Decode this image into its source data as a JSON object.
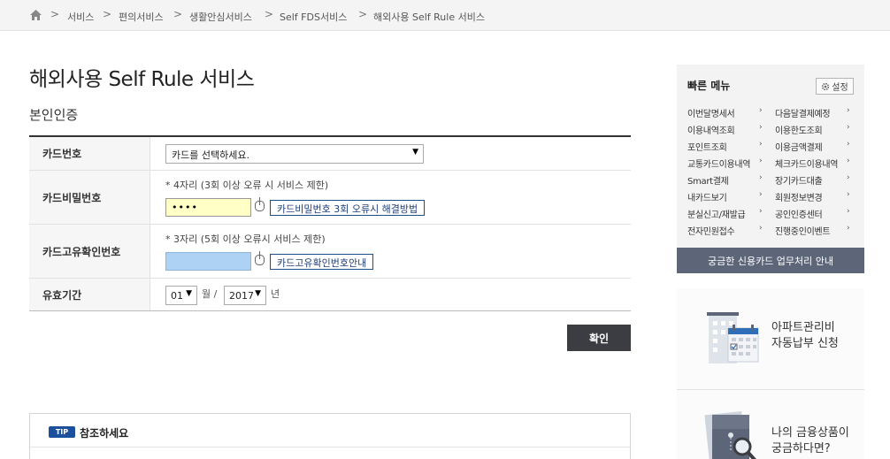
{
  "breadcrumb": {
    "home_icon": "home-icon",
    "items": [
      "서비스",
      "편의서비스",
      "생활안심서비스",
      "Self FDS서비스",
      "해외사용 Self Rule 서비스"
    ]
  },
  "page_title": "해외사용 Self Rule 서비스",
  "section_title": "본인인증",
  "form": {
    "card_number": {
      "label": "카드번호",
      "select_value": "카드를 선택하세요."
    },
    "card_password": {
      "label": "카드비밀번호",
      "note": "* 4자리 (3회 이상 오류 시 서비스 제한)",
      "value": "••••",
      "help_link": "카드비밀번호 3회 오류시 해결방법"
    },
    "card_cvc": {
      "label": "카드고유확인번호",
      "note": "* 3자리 (5회 이상 오류시 서비스 제한)",
      "value": "",
      "help_link": "카드고유확인번호안내"
    },
    "expiry": {
      "label": "유효기간",
      "month": "01",
      "month_unit": "월 /",
      "year": "2017",
      "year_unit": "년"
    }
  },
  "confirm_button": "확인",
  "tip": {
    "badge": "TIP",
    "title": "참조하세요"
  },
  "quick_menu": {
    "title": "빠른 메뉴",
    "settings_label": "설정",
    "settings_icon": "gear-icon",
    "left": [
      "이번달명세서",
      "이용내역조회",
      "포인트조회",
      "교통카드이용내역",
      "Smart결제",
      "내카드보기",
      "분실신고/재발급",
      "전자민원접수"
    ],
    "right": [
      "다음달결제예정",
      "이용한도조회",
      "이용금액결제",
      "체크카드이용내역",
      "장기카드대출",
      "회원정보변경",
      "공인인증센터",
      "진행중인이벤트"
    ],
    "chevron": "›",
    "footer": "궁금한 신용카드 업무처리 안내"
  },
  "banners": [
    {
      "line1": "아파트관리비",
      "line2": "자동납부 신청",
      "icon": "apartment-calendar-icon"
    },
    {
      "line1": "나의 금융상품이",
      "line2": "궁금하다면?",
      "icon": "document-search-icon"
    }
  ],
  "colors": {
    "confirm_bg": "#3c3d42",
    "quick_footer_bg": "#5d6679",
    "tip_badge": "#1c4f9c",
    "password_bg": "#ffffc6",
    "cvc_bg": "#aed2f3"
  }
}
